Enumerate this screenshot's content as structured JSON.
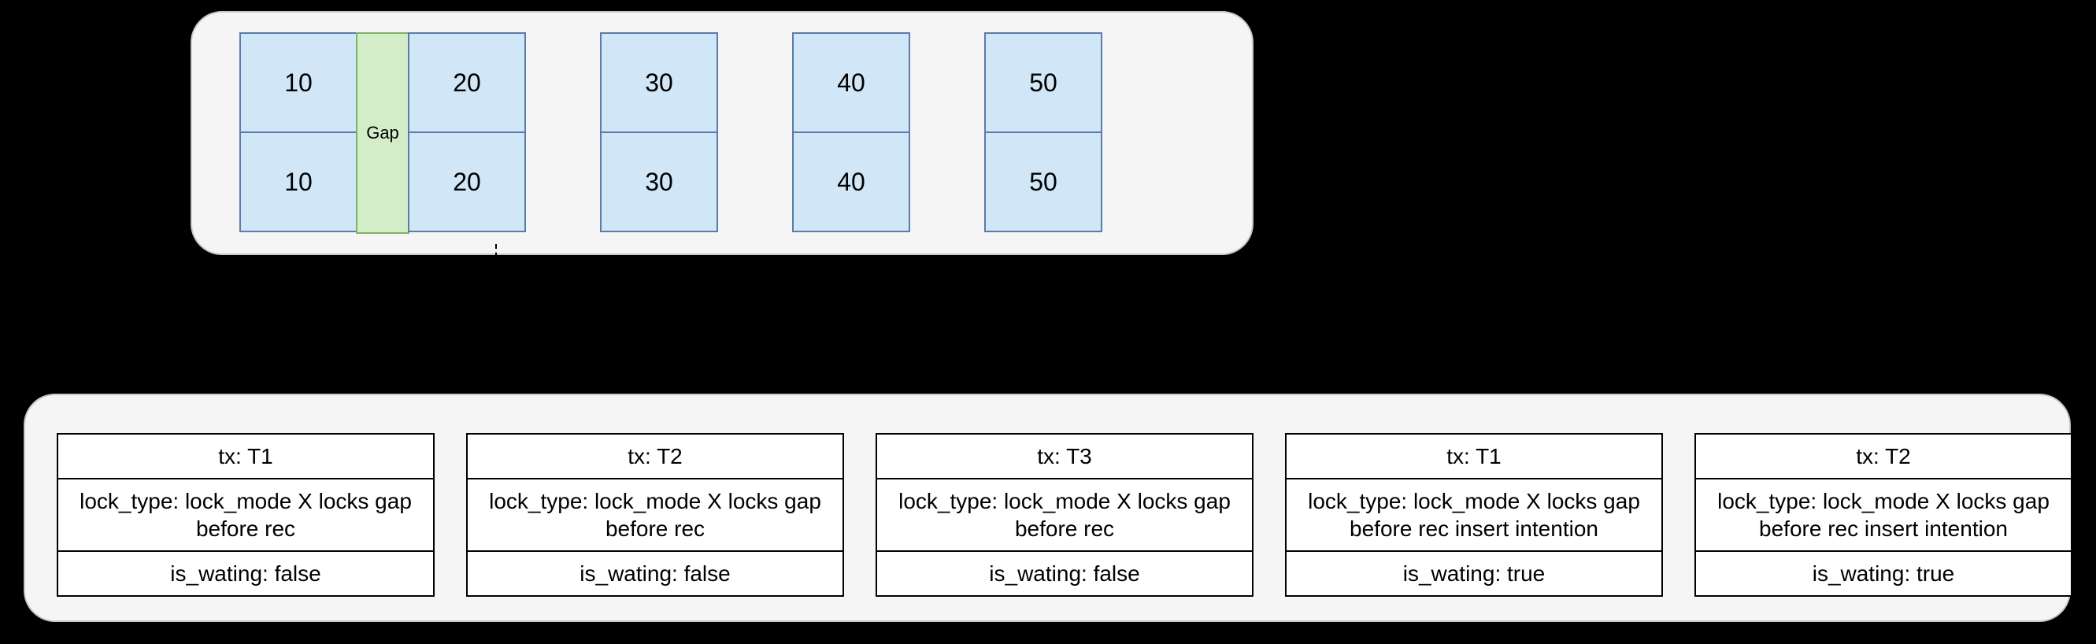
{
  "records": [
    {
      "top": "10",
      "bottom": "10"
    },
    {
      "top": "20",
      "bottom": "20"
    },
    {
      "top": "30",
      "bottom": "30"
    },
    {
      "top": "40",
      "bottom": "40"
    },
    {
      "top": "50",
      "bottom": "50"
    }
  ],
  "gap_label": "Gap",
  "locks": [
    {
      "tx": "tx: T1",
      "lock_type": "lock_type: lock_mode X locks gap before rec",
      "is_waiting": "is_wating: false"
    },
    {
      "tx": "tx: T2",
      "lock_type": "lock_type:  lock_mode X locks gap before rec",
      "is_waiting": "is_wating: false"
    },
    {
      "tx": "tx: T3",
      "lock_type": "lock_type: lock_mode X locks gap before rec",
      "is_waiting": "is_wating: false"
    },
    {
      "tx": "tx: T1",
      "lock_type": "lock_type: lock_mode X locks gap before rec insert intention",
      "is_waiting": "is_wating: true"
    },
    {
      "tx": "tx: T2",
      "lock_type": "lock_type: lock_mode X locks gap before rec insert intention",
      "is_waiting": "is_wating: true"
    }
  ]
}
